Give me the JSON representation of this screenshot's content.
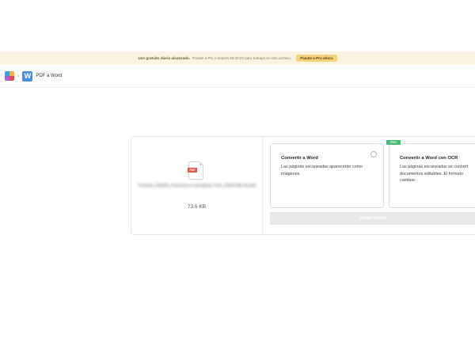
{
  "banner": {
    "bold_text": "Uso gratuito diario alcanzado.",
    "text": "Pásate a Pro o espera 06:40:23 para trabajar en otro archivo.",
    "cta_label": "Pásate a Pro ahora"
  },
  "breadcrumb": {
    "separator": "›",
    "tool_icon_letter": "W",
    "tool_label": "PDF a Word"
  },
  "file": {
    "icon_tag": "PDF",
    "name": "Factura_00036_Francisco Carugnas Tost_2023-08-18.pdf",
    "size": "73.6 KB"
  },
  "options": [
    {
      "title": "Convertir a Word",
      "description": "Las páginas escaneadas aparecerán como imágenes."
    },
    {
      "badge": "PRO",
      "title": "Convertir a Word con OCR",
      "description": "Las páginas escaneadas se convert documentos editables. El formato cambiar."
    }
  ],
  "choose_button": {
    "label": "Elegir opción",
    "arrow": "→"
  }
}
